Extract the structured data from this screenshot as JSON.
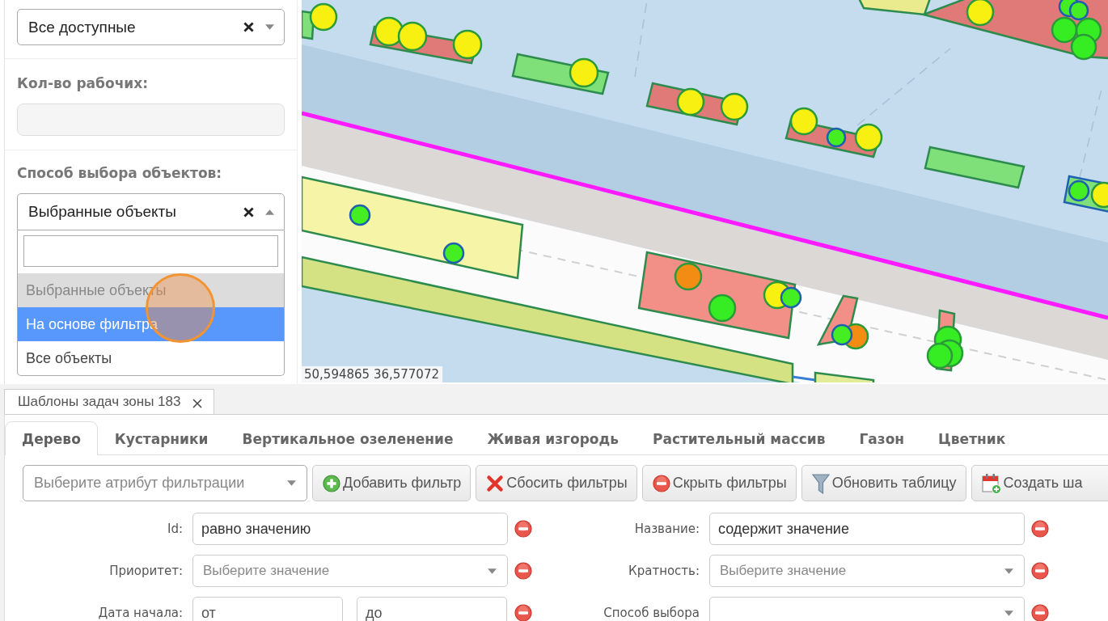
{
  "sidebar": {
    "scope_select": {
      "value": "Все доступные"
    },
    "workers_count": {
      "label": "Кол-во рабочих:"
    },
    "selection_method": {
      "label": "Способ выбора объектов:",
      "value": "Выбранные объекты",
      "expanded": true,
      "options": [
        {
          "label": "Выбранные объекты",
          "selected": true,
          "highlighted": false
        },
        {
          "label": "На основе фильтра",
          "selected": false,
          "highlighted": true
        },
        {
          "label": "Все объекты",
          "selected": false,
          "highlighted": false
        }
      ]
    }
  },
  "map": {
    "coordinates": "50,594865 36,577072"
  },
  "document_tabs": [
    {
      "label": "Шаблоны задач зоны 183",
      "selected": true
    }
  ],
  "category_tabs": [
    {
      "label": "Дерево",
      "selected": true
    },
    {
      "label": "Кустарники",
      "selected": false
    },
    {
      "label": "Вертикальное озеленение",
      "selected": false
    },
    {
      "label": "Живая изгородь",
      "selected": false
    },
    {
      "label": "Растительный массив",
      "selected": false
    },
    {
      "label": "Газон",
      "selected": false
    },
    {
      "label": "Цветник",
      "selected": false
    }
  ],
  "toolbar": {
    "attribute_select": {
      "placeholder": "Выберите атрибут фильтрации"
    },
    "buttons": [
      {
        "label": "Добавить фильтр",
        "kind": "add"
      },
      {
        "label": "Сбосить фильтры",
        "kind": "clear"
      },
      {
        "label": "Скрыть фильтры",
        "kind": "hide"
      },
      {
        "label": "Обновить таблицу",
        "kind": "refresh"
      },
      {
        "label": "Создать ша",
        "kind": "create"
      }
    ]
  },
  "filters": [
    {
      "label": "Id:",
      "kind": "text",
      "value": "равно значению"
    },
    {
      "label": "Название:",
      "kind": "text",
      "value": "содержит значение"
    },
    {
      "label": "Приоритет:",
      "kind": "select",
      "placeholder": "Выберите значение"
    },
    {
      "label": "Кратность:",
      "kind": "select",
      "placeholder": "Выберите значение"
    },
    {
      "label": "Дата начала:",
      "kind": "range",
      "from": {
        "placeholder": "от"
      },
      "to": {
        "placeholder": "до"
      }
    },
    {
      "label": "Способ выбора",
      "kind": "select"
    }
  ]
}
